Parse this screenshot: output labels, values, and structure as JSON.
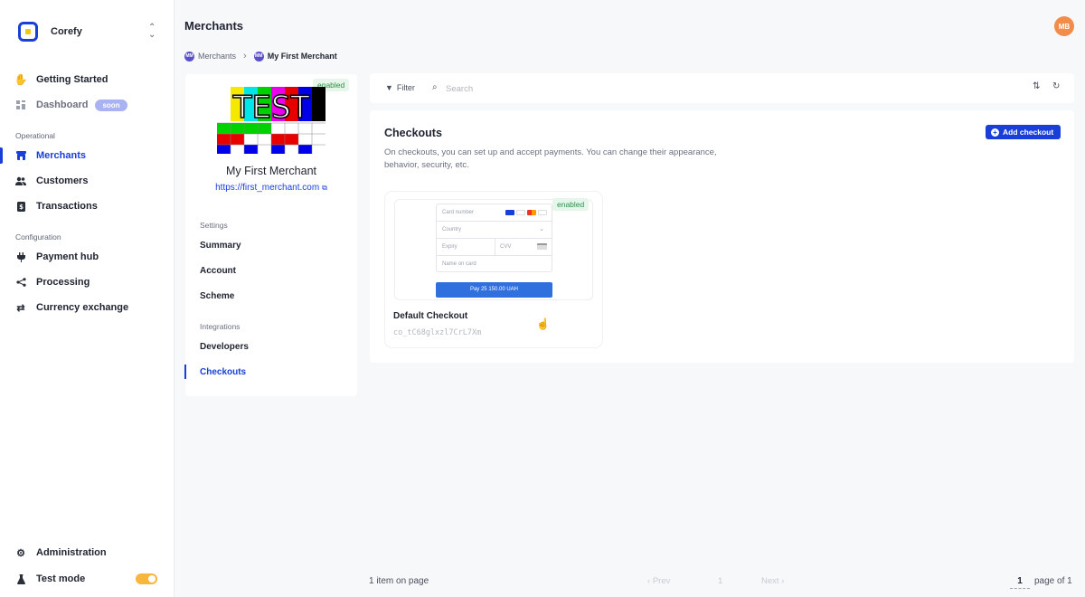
{
  "sidebar": {
    "brand": "Corefy",
    "items": {
      "getting_started": "Getting Started",
      "dashboard": "Dashboard",
      "dashboard_badge": "soon",
      "merchants": "Merchants",
      "customers": "Customers",
      "transactions": "Transactions",
      "payment_hub": "Payment hub",
      "processing": "Processing",
      "currency_exchange": "Currency exchange",
      "administration": "Administration",
      "test_mode": "Test mode"
    },
    "sections": {
      "operational": "Operational",
      "configuration": "Configuration"
    }
  },
  "header": {
    "title": "Merchants",
    "avatar": "MB",
    "breadcrumb": {
      "root_badge": "MM",
      "root": "Merchants",
      "current_badge": "MM",
      "current": "My First Merchant"
    }
  },
  "merchant": {
    "status": "enabled",
    "name": "My First Merchant",
    "url": "https://first_merchant.com",
    "logo_text": "TEST",
    "sections": {
      "settings": "Settings",
      "integrations": "Integrations"
    },
    "links": {
      "summary": "Summary",
      "account": "Account",
      "scheme": "Scheme",
      "developers": "Developers",
      "checkouts": "Checkouts"
    }
  },
  "toolbar": {
    "filter_label": "Filter",
    "search_placeholder": "Search"
  },
  "checkouts": {
    "title": "Checkouts",
    "description": "On checkouts, you can set up and accept payments. You can change their appearance, behavior, security, etc.",
    "add_label": "Add checkout",
    "card": {
      "status": "enabled",
      "name": "Default Checkout",
      "id": "co_tC68glxzl7CrL7Xm",
      "preview": {
        "card_number": "Card number",
        "country": "Country",
        "expiry": "Expiry",
        "cvv": "CVV",
        "name_on_card": "Name on card",
        "pay_label": "Pay 25 150.00 UAH"
      }
    }
  },
  "pagination": {
    "count_text": "1 item on page",
    "prev": "Prev",
    "page_number": "1",
    "next": "Next",
    "current_page": "1",
    "of_text": "page of 1"
  },
  "colors": {
    "accent": "#1a3fd8",
    "enabled_bg": "#e6f6ea",
    "enabled_text": "#2e8f49",
    "avatar": "#f28c4b",
    "toggle_on": "#f6b73c"
  }
}
